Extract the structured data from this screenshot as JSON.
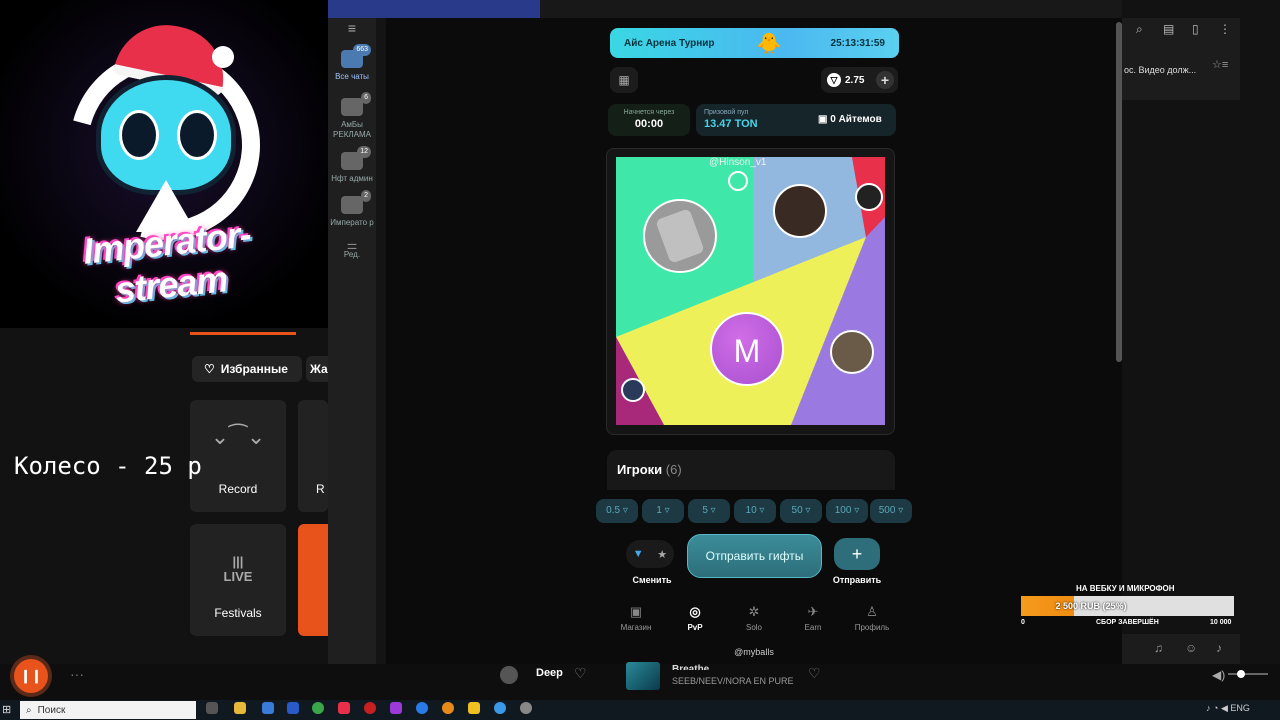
{
  "stream": {
    "brand": "Imperator-stream",
    "wheel_text": "Колесо - 25 р"
  },
  "music_app": {
    "favorites_label": "Избранные",
    "genre_partial": "Жа",
    "cards": [
      {
        "label": "Record",
        "icon": "record-wings-icon"
      },
      {
        "label": "R",
        "icon": "partial-icon"
      },
      {
        "label": "Festivals",
        "icon": "live-icon",
        "icon_text": "LIVE"
      }
    ]
  },
  "telegram_sidebar": {
    "items": [
      {
        "label": "Все чаты",
        "badge": "663"
      },
      {
        "label": "АмБы РЕКЛАМА",
        "badge": "6"
      },
      {
        "label": "Нфт админ",
        "badge": "12"
      },
      {
        "label": "Императо р",
        "badge": "2"
      },
      {
        "label": "Ред.",
        "badge": ""
      }
    ]
  },
  "mini_app": {
    "banner": {
      "title": "Айс Арена Турнир",
      "timer": "25:13:31:59"
    },
    "balance": "2.75",
    "starts_in": {
      "label": "Начнется через",
      "value": "00:00"
    },
    "prize_pool": {
      "label": "Призовой пул",
      "value": "13.47 TON"
    },
    "items_count": "0 Айтемов",
    "board_handle": "@Hinson_v1",
    "center_avatar_letter": "M",
    "players": {
      "label": "Игроки",
      "count": "(6)"
    },
    "bets": [
      "0.5",
      "1",
      "5",
      "10",
      "50",
      "100",
      "500"
    ],
    "swap_label": "Сменить",
    "send_gifts_label": "Отправить гифты",
    "send_label": "Отправить",
    "nav": [
      {
        "label": "Магазин",
        "icon": "shop-icon"
      },
      {
        "label": "PvP",
        "icon": "pvp-icon"
      },
      {
        "label": "Solo",
        "icon": "solo-icon"
      },
      {
        "label": "Earn",
        "icon": "earn-icon"
      },
      {
        "label": "Профиль",
        "icon": "profile-icon"
      }
    ],
    "footer": "@myballs"
  },
  "right_panel": {
    "message_preview": "ос. Видео долж..."
  },
  "donation": {
    "title": "НА ВЕБКУ И МИКРОФОН",
    "progress_text": "2 500 RUB (25%)",
    "progress": 0.25,
    "min": "0",
    "status": "СБОР ЗАВЕРШЁН",
    "max": "10 000"
  },
  "player": {
    "track": "Deep",
    "title_partial": "Breathe",
    "artist": "SEEB/NEEV/NORA EN PURE"
  },
  "taskbar": {
    "search_placeholder": "Поиск",
    "lang": "ENG"
  },
  "colors": {
    "accent_orange": "#e8531c",
    "teal": "#48d4e8",
    "board_green": "#3fe8a8",
    "board_yellow": "#eef05a",
    "board_purple": "#9a7ae0"
  }
}
